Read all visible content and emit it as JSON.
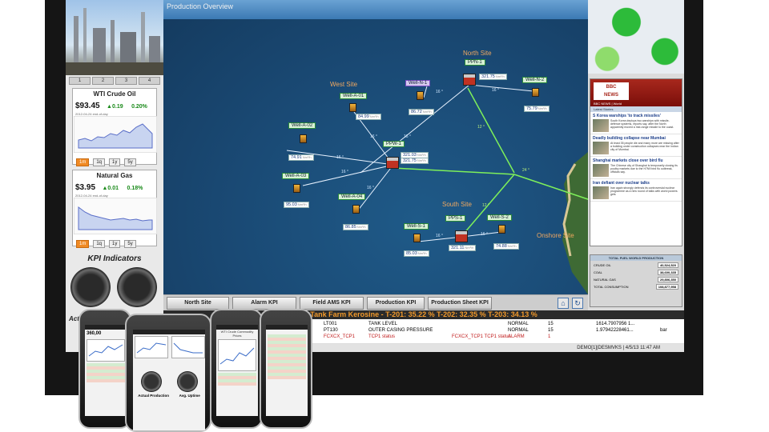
{
  "map": {
    "title": "Production Overview"
  },
  "sites": {
    "north": "North Site",
    "west": "West Site",
    "south": "South Site",
    "onshore": "Onshore Site"
  },
  "wells": {
    "ppn1": {
      "name": "PPN-1",
      "value": "321.75"
    },
    "welln1": {
      "name": "Well-N-1",
      "value": "86.72"
    },
    "welln2": {
      "name": "Well-N-2",
      "value": "75.79"
    },
    "wella01": {
      "name": "Well-A-01",
      "value": "84.99"
    },
    "wella02": {
      "name": "Well-A-02",
      "value": "74.91"
    },
    "wella03": {
      "name": "Well-A-03",
      "value": "95.03"
    },
    "wella04": {
      "name": "Well-A-04",
      "value": "86.85"
    },
    "ppw1": {
      "name": "PPW-1",
      "value1": "321.03",
      "value2": "321.75"
    },
    "pps1": {
      "name": "PPS-1",
      "value": "321.11"
    },
    "wells1": {
      "name": "Well-S-1",
      "value": "85.03"
    },
    "wells2": {
      "name": "Well-S-2",
      "value": "74.88"
    }
  },
  "connection_labels": [
    "16 °",
    "16 °",
    "16 °",
    "16 °",
    "16 °",
    "16 °",
    "16 °",
    "16 °",
    "16 °"
  ],
  "pipe_labels": {
    "a": "12 °",
    "b": "24 °",
    "c": "12 °"
  },
  "units": {
    "flow": "Nm³/h"
  },
  "nav": [
    "North Site",
    "Alarm KPI",
    "Field AMS KPI",
    "Production KPI",
    "Production Sheet KPI"
  ],
  "nav_icons": [
    "home-icon",
    "refresh-icon"
  ],
  "left": {
    "tabs": [
      "1",
      "2",
      "3",
      "4"
    ],
    "wti": {
      "title": "WTI Crude Oil",
      "price": "$93.45",
      "change": "▲0.19",
      "pct": "0.20%",
      "date": "2012-04-24 end-of-day",
      "periods": [
        "1m",
        "1q",
        "1y",
        "5y"
      ]
    },
    "gas": {
      "title": "Natural Gas",
      "price": "$3.95",
      "change": "▲0.01",
      "pct": "0.18%",
      "date": "2012-04-24 end-of-day",
      "periods": [
        "1m",
        "1q",
        "1y",
        "5y"
      ]
    },
    "kpi_title": "KPI Indicators",
    "kpi_caption": "Act"
  },
  "news": {
    "logo_line1": "BBC",
    "logo_line2": "NEWS",
    "subtitle": "BBC NEWS | World",
    "bar": "Latest Stories",
    "stories": [
      {
        "title": "S Korea warships 'to track missiles'",
        "text": "South Korea deploys two warships with missile-defence systems, reports say, after the North apparently moved a mid-range missile to the coast."
      },
      {
        "title": "Deadly building collapse near Mumbai",
        "text": "At least 35 people die and many more are missing after a building under construction collapses near the Indian city of Mumbai."
      },
      {
        "title": "Shanghai markets close over bird flu",
        "text": "The Chinese city of Shanghai is temporarily closing its poultry markets due to the H7N9 bird flu outbreak, officials say."
      },
      {
        "title": "Iran defiant over nuclear talks",
        "text": "Iran again strongly defends its controversial nuclear programme as a new round of talks with world powers gets"
      }
    ]
  },
  "production_panel": {
    "title": "TOTAL FUEL WORLD PRODUCTION",
    "rows": [
      {
        "label": "CRUDE OIL",
        "value": "40,524,520"
      },
      {
        "label": "COAL",
        "value": "38,600,335"
      },
      {
        "label": "NATURAL GAS",
        "value": "29,806,350"
      },
      {
        "label": "TOTAL CONSUMPTION",
        "value": "108,877,958"
      }
    ]
  },
  "tank_bar": "Tank Farm Kerosine - T-201: 35.22 %  T-202: 32.35 %  T-203: 34.13 %",
  "alarms": [
    {
      "tag": "LT001",
      "desc": "TANK LEVEL",
      "state": "NORMAL",
      "prio": "15",
      "value": "1614.7907956 1...",
      "unit": "",
      "red": false
    },
    {
      "tag": "PT130",
      "desc": "OUTER CASING PRESSURE",
      "state": "NORMAL",
      "prio": "15",
      "value": "1.97942228461...",
      "unit": "bar",
      "red": false
    },
    {
      "tag": "FCXCX_TCP1",
      "desc": "TCP1 status",
      "extra": "FCXCX_TCP1 TCP1 status",
      "state": "ALARM",
      "prio": "1",
      "value": "",
      "unit": "",
      "red": true
    }
  ],
  "status_bar": "DEMO[1]|DESMVKS | 4/5/13 11:47 AM",
  "phones": {
    "p2_labels": [
      "Actual Production",
      "Avg. Uptime"
    ],
    "p1_text": "360,00",
    "p3_title": "WTI Crude Commodity Prices"
  }
}
